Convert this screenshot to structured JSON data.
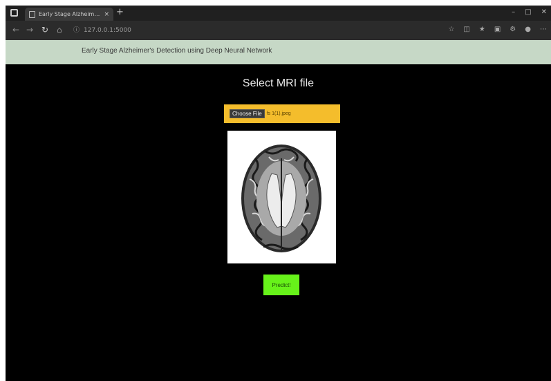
{
  "browser": {
    "tab_title": "Early Stage Alzheimer's Detecti...",
    "tab_close": "×",
    "new_tab": "+",
    "url": "127.0.0.1:5000",
    "window_controls": [
      "–",
      "□",
      "✕"
    ],
    "nav_icons": [
      "back-arrow-icon",
      "forward-arrow-icon",
      "refresh-icon",
      "home-icon"
    ],
    "toolbar_icons": [
      "favorite-star-icon",
      "split-screen-icon",
      "favorites-icon",
      "collections-icon",
      "extensions-icon",
      "profile-icon",
      "more-menu-icon"
    ]
  },
  "header": {
    "title": "Early Stage Alzheimer's Detection using Deep Neural Network",
    "background": "#c6d8c6"
  },
  "main": {
    "heading": "Select MRI file",
    "file_input": {
      "button_label": "Choose File",
      "file_name": "fs 1(1).jpeg",
      "background": "#f4bd2c"
    },
    "preview_alt": "brain-mri-axial-slice",
    "predict_label": "Predict!",
    "predict_color": "#67f21a"
  }
}
